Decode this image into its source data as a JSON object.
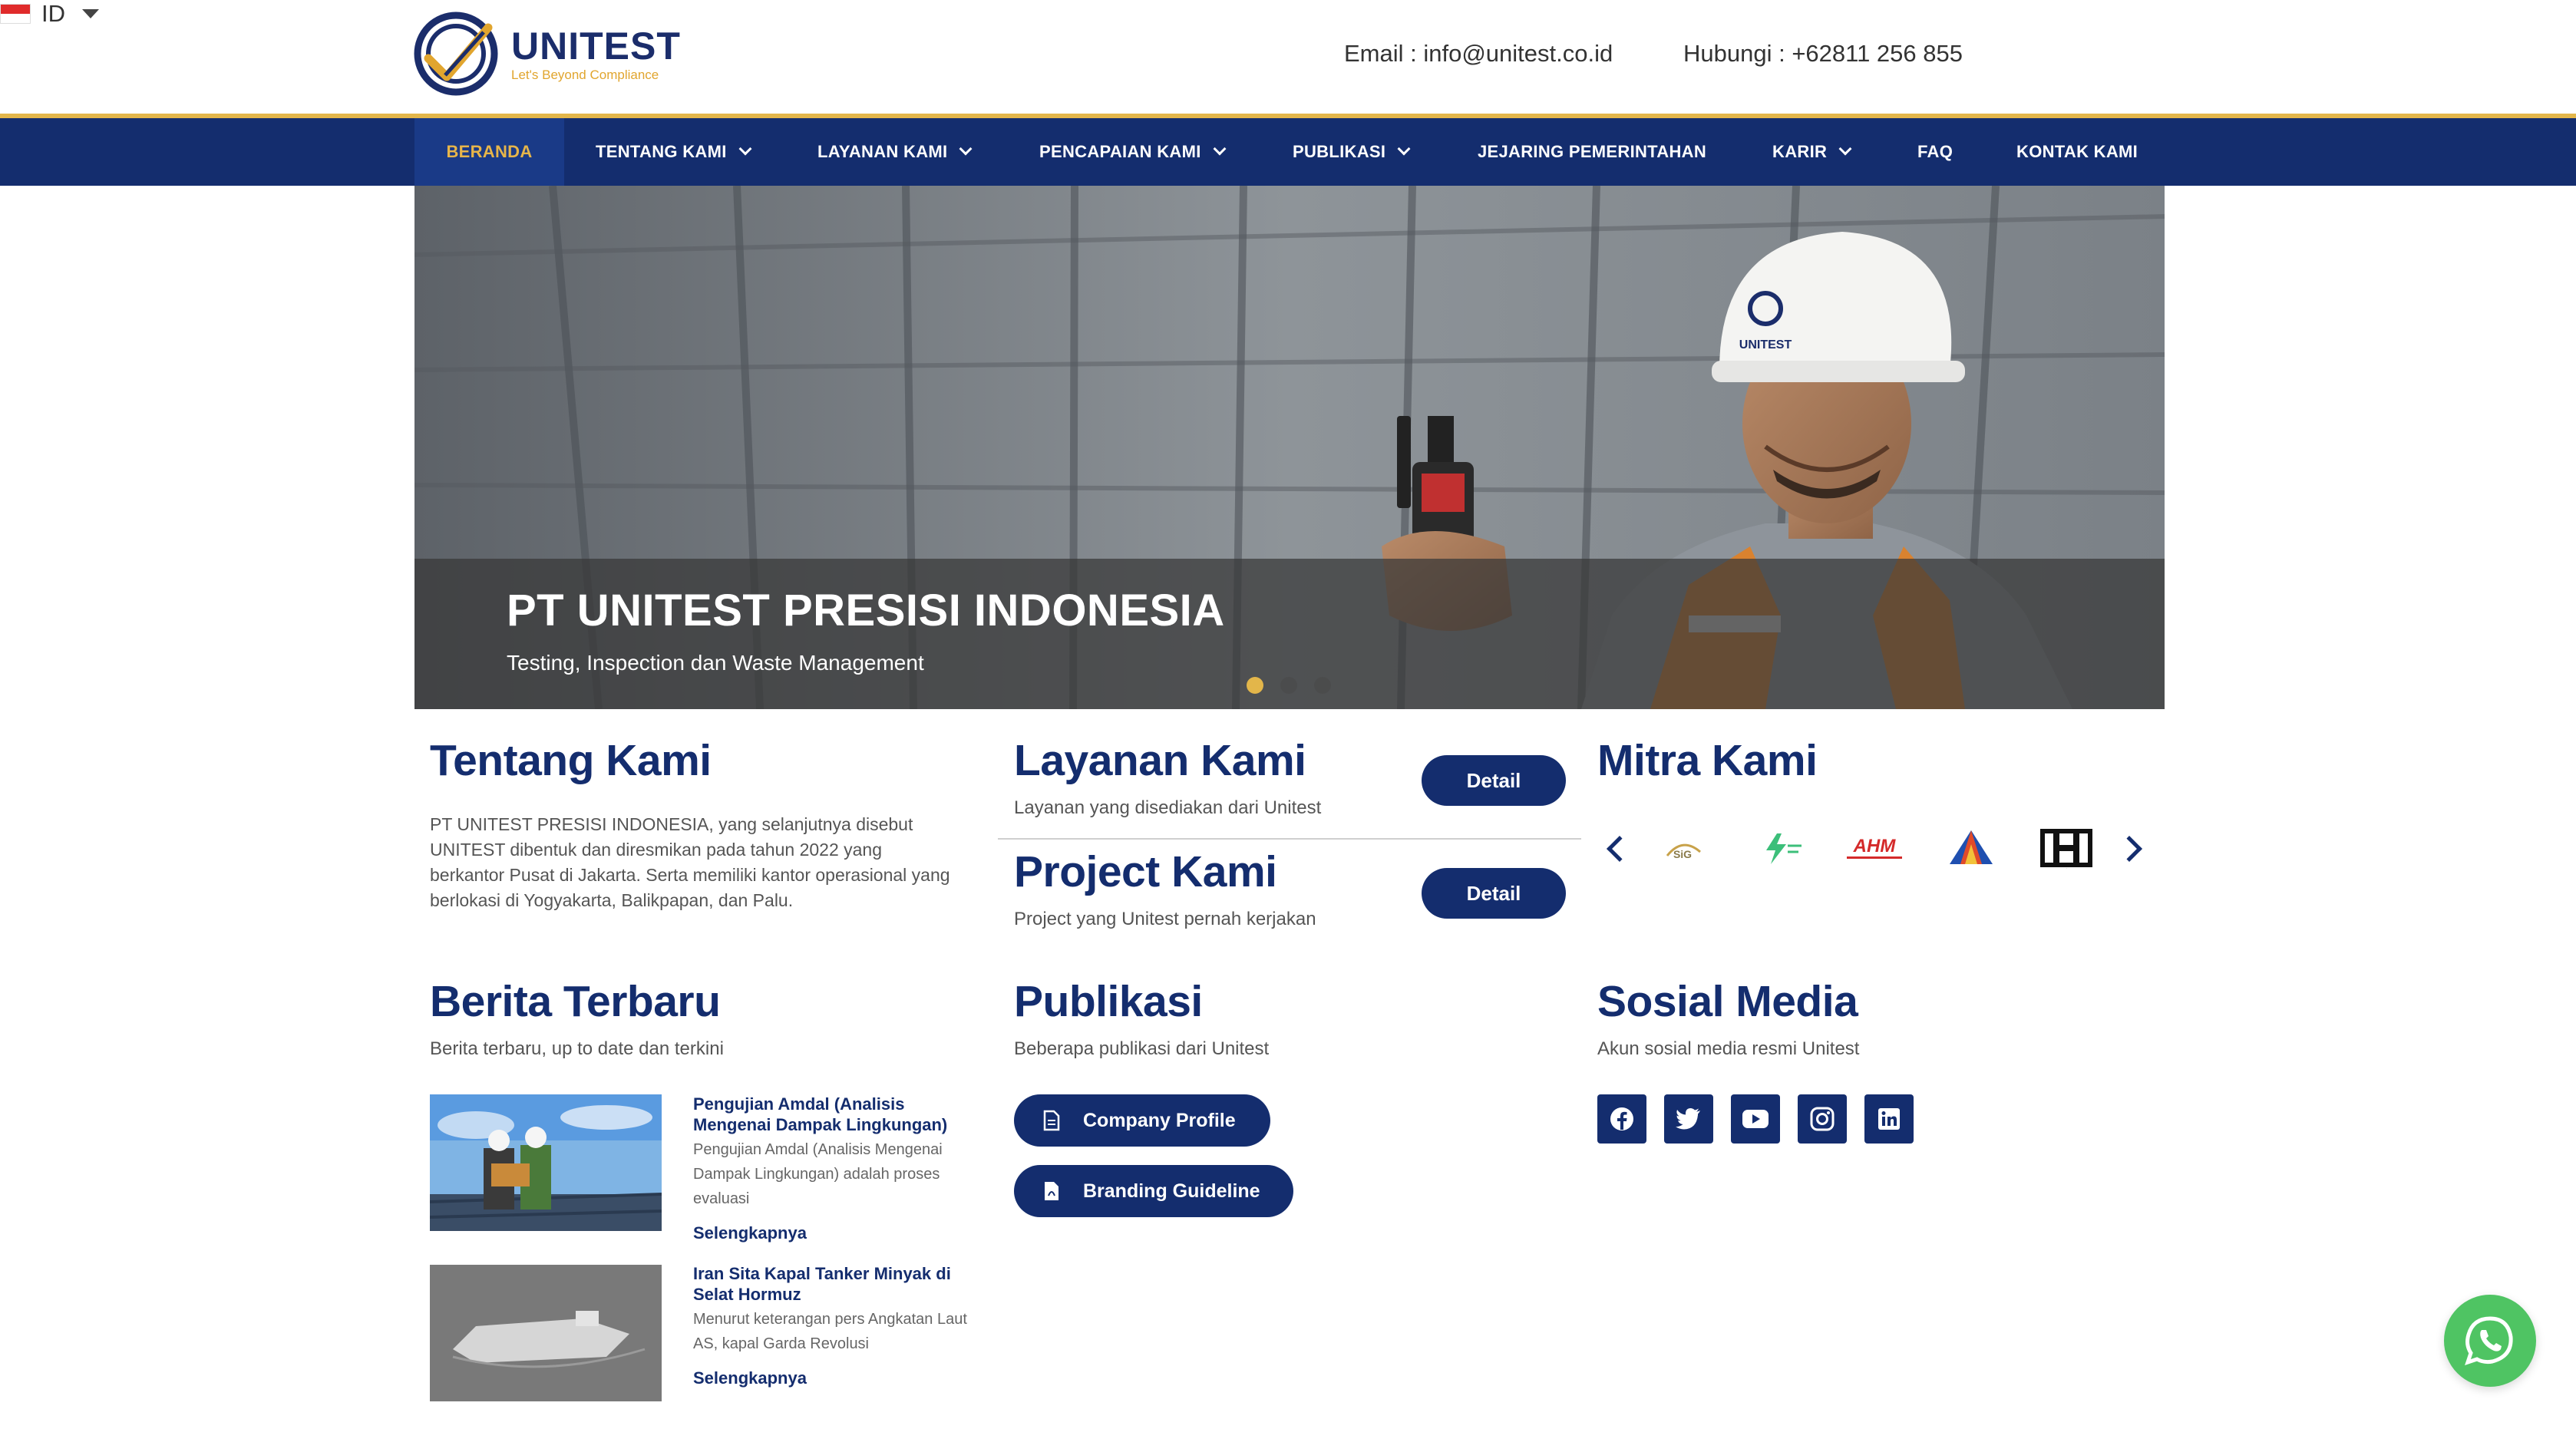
{
  "header": {
    "logo_name": "UNITEST",
    "logo_tagline": "Let's Beyond Compliance",
    "email": "Email : info@unitest.co.id",
    "phone": "Hubungi : +62811 256 855",
    "language": "ID"
  },
  "nav": {
    "items": [
      {
        "label": "BERANDA",
        "active": true
      },
      {
        "label": "TENTANG KAMI",
        "dropdown": true
      },
      {
        "label": "LAYANAN KAMI",
        "dropdown": true
      },
      {
        "label": "PENCAPAIAN KAMI",
        "dropdown": true
      },
      {
        "label": "PUBLIKASI",
        "dropdown": true
      },
      {
        "label": "JEJARING PEMERINTAHAN"
      },
      {
        "label": "KARIR",
        "dropdown": true
      },
      {
        "label": "FAQ"
      },
      {
        "label": "KONTAK KAMI"
      }
    ]
  },
  "hero": {
    "title": "PT UNITEST PRESISI INDONESIA",
    "subtitle": "Testing, Inspection dan Waste Management",
    "helmet_text": "UNITEST",
    "slides": 3,
    "active_slide": 1
  },
  "tentang": {
    "title": "Tentang Kami",
    "text": "PT UNITEST PRESISI INDONESIA, yang selanjutnya disebut UNITEST dibentuk dan diresmikan pada tahun 2022 yang berkantor Pusat di Jakarta. Serta memiliki kantor operasional yang berlokasi di Yogyakarta, Balikpapan, dan Palu."
  },
  "layanan": {
    "title": "Layanan Kami",
    "subtitle": "Layanan yang disediakan dari Unitest",
    "button": "Detail"
  },
  "project": {
    "title": "Project Kami",
    "subtitle": "Project yang Unitest pernah kerjakan",
    "button": "Detail"
  },
  "mitra": {
    "title": "Mitra Kami",
    "partners": [
      "SiG",
      "",
      "AHM",
      "",
      "H"
    ]
  },
  "berita": {
    "title": "Berita Terbaru",
    "subtitle": "Berita terbaru, up to date dan terkini",
    "items": [
      {
        "title": "Pengujian Amdal (Analisis Mengenai Dampak Lingkungan)",
        "excerpt": "Pengujian Amdal (Analisis Mengenai Dampak Lingkungan) adalah proses evaluasi",
        "more": "Selengkapnya"
      },
      {
        "title": "Iran Sita Kapal Tanker Minyak di Selat Hormuz",
        "excerpt": "Menurut keterangan pers Angkatan Laut AS, kapal Garda Revolusi",
        "more": "Selengkapnya"
      }
    ]
  },
  "publikasi": {
    "title": "Publikasi",
    "subtitle": "Beberapa publikasi dari Unitest",
    "buttons": [
      "Company Profile",
      "Branding Guideline"
    ]
  },
  "sosial": {
    "title": "Sosial Media",
    "subtitle": "Akun sosial media resmi Unitest",
    "icons": [
      "facebook-icon",
      "twitter-icon",
      "youtube-icon",
      "instagram-icon",
      "linkedin-icon"
    ]
  },
  "colors": {
    "navy": "#142d6e",
    "gold": "#e3b64a",
    "whatsapp": "#4fc463"
  }
}
